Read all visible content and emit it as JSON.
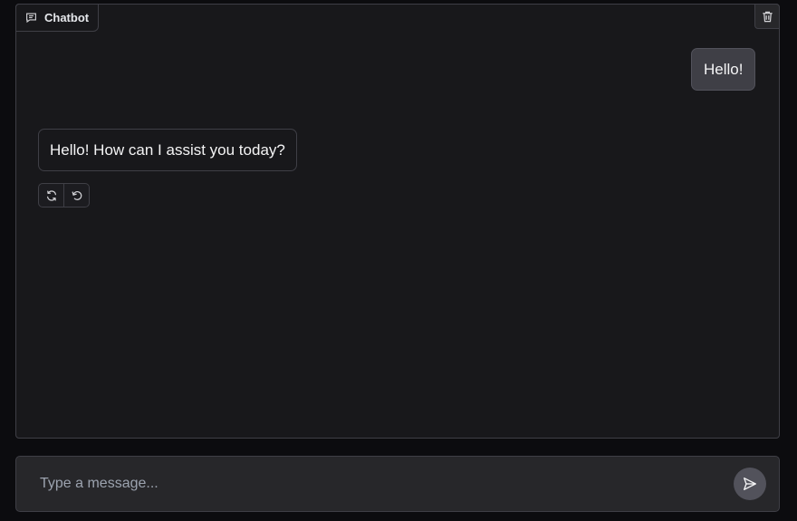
{
  "chatbot": {
    "label": "Chatbot",
    "label_icon": "chat-bubble-icon",
    "clear_icon": "trash-icon"
  },
  "messages": [
    {
      "role": "user",
      "text": "Hello!"
    },
    {
      "role": "assistant",
      "text": "Hello! How can I assist you today?"
    }
  ],
  "assistant_actions": [
    {
      "icon": "retry-icon"
    },
    {
      "icon": "undo-icon"
    }
  ],
  "composer": {
    "placeholder": "Type a message...",
    "value": "",
    "send_icon": "send-icon"
  },
  "colors": {
    "background": "#0c0c0f",
    "panel": "#18181b",
    "border": "#3f3f46",
    "user_bubble": "#3f3f46"
  }
}
